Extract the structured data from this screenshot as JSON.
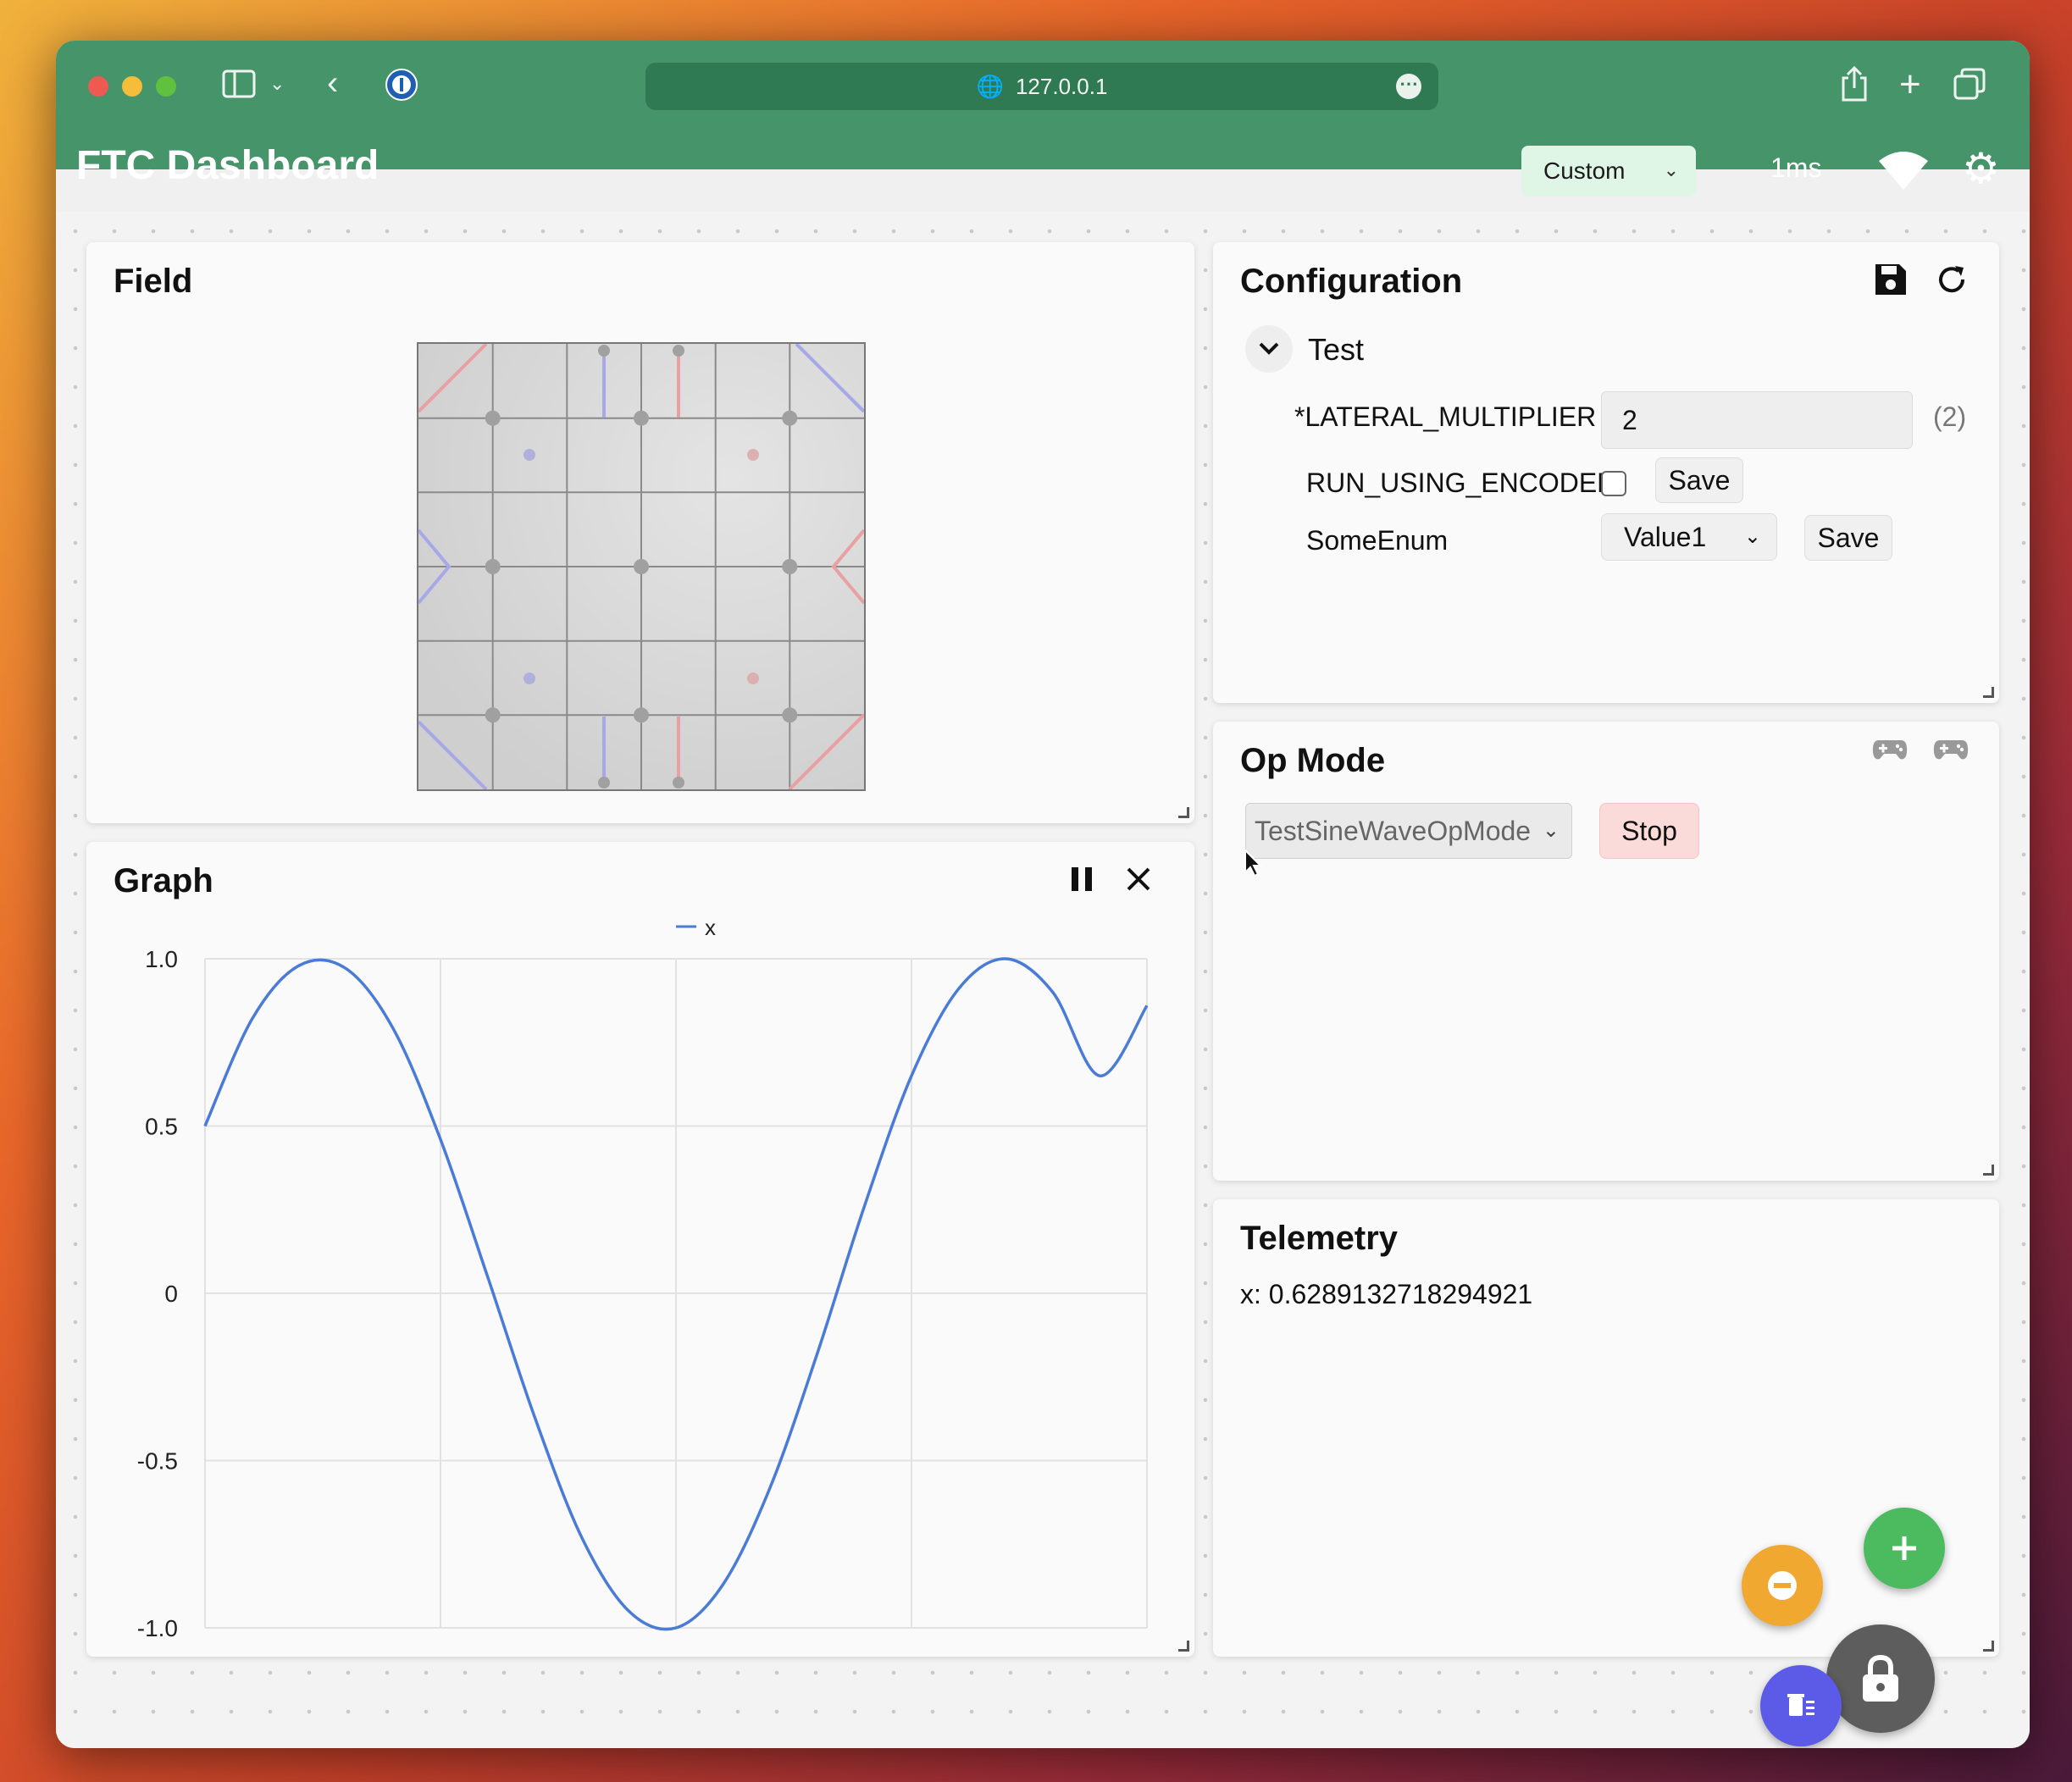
{
  "browser": {
    "url": "127.0.0.1"
  },
  "header": {
    "app_title": "FTC Dashboard",
    "layout_select": "Custom",
    "latency": "1ms"
  },
  "field_panel": {
    "title": "Field"
  },
  "config_panel": {
    "title": "Configuration",
    "group": "Test",
    "rows": {
      "lateral": {
        "label": "*LATERAL_MULTIPLIER",
        "value": "2",
        "current": "(2)"
      },
      "encoder": {
        "label": "RUN_USING_ENCODER",
        "checked": false,
        "save": "Save"
      },
      "enum": {
        "label": "SomeEnum",
        "value": "Value1",
        "save": "Save"
      }
    }
  },
  "opmode_panel": {
    "title": "Op Mode",
    "selected": "TestSineWaveOpMode",
    "stop_label": "Stop"
  },
  "graph_panel": {
    "title": "Graph"
  },
  "telemetry_panel": {
    "title": "Telemetry",
    "line": "x: 0.6289132718294921"
  },
  "chart_data": {
    "type": "line",
    "series": [
      {
        "name": "x"
      }
    ],
    "x_range": [
      0,
      1
    ],
    "ylim": [
      -1.0,
      1.0
    ],
    "yticks": [
      "1.0",
      "0.5",
      "0",
      "-0.5",
      "-1.0"
    ],
    "grid": true,
    "legend": "top-center",
    "x": [
      0,
      0.05,
      0.1,
      0.15,
      0.2,
      0.25,
      0.3,
      0.35,
      0.4,
      0.45,
      0.5,
      0.55,
      0.6,
      0.65,
      0.7,
      0.75,
      0.8,
      0.85,
      0.9,
      0.95,
      1.0
    ],
    "y": [
      0.5,
      0.82,
      0.98,
      0.97,
      0.79,
      0.46,
      0.05,
      -0.37,
      -0.73,
      -0.95,
      -1.0,
      -0.87,
      -0.58,
      -0.18,
      0.26,
      0.65,
      0.91,
      1.0,
      0.9,
      0.65,
      0.86
    ]
  },
  "colors": {
    "chrome": "#46946a",
    "line": "#4a7bd6",
    "fab_add": "#4cba5f",
    "fab_remove": "#f0a830",
    "fab_clear": "#5b5be8",
    "fab_lock": "#5d5d5d"
  },
  "icons": {
    "save": "floppy-disk-icon",
    "refresh": "refresh-icon",
    "pause": "pause-icon",
    "close": "close-icon",
    "gamepad": "gamepad-icon",
    "settings": "gear-icon",
    "wifi": "wifi-icon"
  }
}
